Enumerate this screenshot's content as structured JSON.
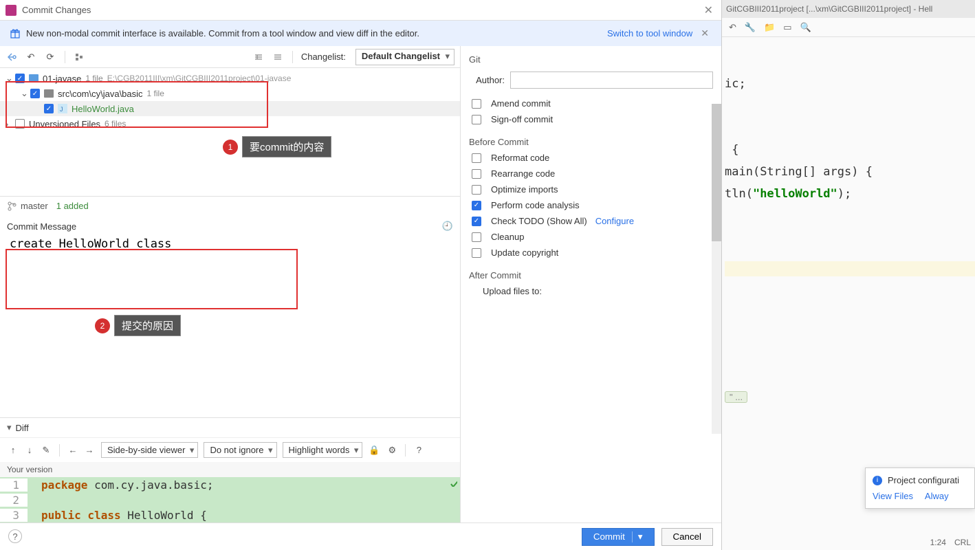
{
  "dialog": {
    "title": "Commit Changes",
    "notice_text": "New non-modal commit interface is available. Commit from a tool window and view diff in the editor.",
    "notice_link": "Switch to tool window"
  },
  "changelist": {
    "label": "Changelist:",
    "selected": "Default Changelist"
  },
  "tree": {
    "root": {
      "name": "01-javase",
      "file_count": "1 file",
      "path": "E:\\CGB2011III\\xm\\GitCGBIII2011project\\01-javase"
    },
    "folder": {
      "name": "src\\com\\cy\\java\\basic",
      "file_count": "1 file"
    },
    "file": {
      "name": "HelloWorld.java"
    },
    "unversioned": {
      "label": "Unversioned Files",
      "count": "6 files"
    }
  },
  "annotations": {
    "a1": "要commit的内容",
    "a2": "提交的原因"
  },
  "branch": {
    "name": "master",
    "added": "1 added"
  },
  "commit_message": {
    "label": "Commit Message",
    "value": "create HelloWorld class"
  },
  "diff": {
    "label": "Diff",
    "viewer": "Side-by-side viewer",
    "ignore": "Do not ignore",
    "highlight": "Highlight words",
    "your_version": "Your version",
    "lines": [
      {
        "n": "1",
        "text": "package com.cy.java.basic;"
      },
      {
        "n": "2",
        "text": ""
      },
      {
        "n": "3",
        "text": "public class HelloWorld {"
      }
    ]
  },
  "right": {
    "git_header": "Git",
    "author_label": "Author:",
    "author_value": "",
    "amend": "Amend commit",
    "signoff": "Sign-off commit",
    "before_header": "Before Commit",
    "reformat": "Reformat code",
    "rearrange": "Rearrange code",
    "optimize": "Optimize imports",
    "analysis": "Perform code analysis",
    "todo": "Check TODO (Show All)",
    "configure": "Configure",
    "cleanup": "Cleanup",
    "copyright": "Update copyright",
    "after_header": "After Commit",
    "upload": "Upload files to:"
  },
  "buttons": {
    "commit": "Commit",
    "cancel": "Cancel"
  },
  "background": {
    "title": "GitCGBIII2011project [...\\xm\\GitCGBIII2011project] - Hell",
    "code_l1": "ic;",
    "code_l2": " {",
    "code_l3a": "main",
    "code_l3b": "(String[] args) {",
    "code_l4a": "tln(",
    "code_l4b": "\"helloWorld\"",
    "code_l4c": ");",
    "folded": "\"    ...",
    "popup_title": "Project configurati",
    "popup_view": "View Files",
    "popup_always": "Alway",
    "status_pos": "1:24",
    "status_enc": "CRL"
  }
}
